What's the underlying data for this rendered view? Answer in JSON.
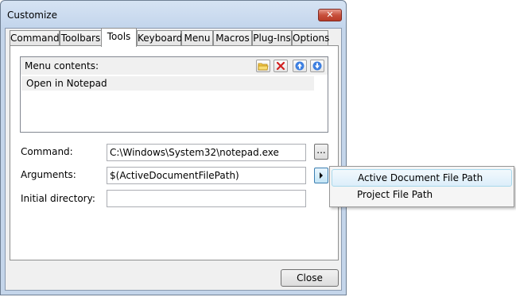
{
  "window": {
    "title": "Customize"
  },
  "tabs": [
    {
      "label": "Commands",
      "active": false
    },
    {
      "label": "Toolbars",
      "active": false
    },
    {
      "label": "Tools",
      "active": true
    },
    {
      "label": "Keyboard",
      "active": false
    },
    {
      "label": "Menu",
      "active": false
    },
    {
      "label": "Macros",
      "active": false
    },
    {
      "label": "Plug-Ins",
      "active": false
    },
    {
      "label": "Options",
      "active": false
    }
  ],
  "menu_contents": {
    "label": "Menu contents:",
    "toolbar_icons": [
      "new-folder-icon",
      "delete-icon",
      "move-up-icon",
      "move-down-icon"
    ],
    "items": [
      "Open in Notepad"
    ]
  },
  "form": {
    "command_label": "Command:",
    "command_value": "C:\\Windows\\System32\\notepad.exe",
    "arguments_label": "Arguments:",
    "arguments_value": "$(ActiveDocumentFilePath)",
    "initial_directory_label": "Initial directory:",
    "initial_directory_value": "",
    "browse_label": "..."
  },
  "footer": {
    "close_label": "Close"
  },
  "arguments_menu": {
    "items": [
      "Active Document File Path",
      "Project File Path"
    ],
    "highlighted_index": 0
  }
}
